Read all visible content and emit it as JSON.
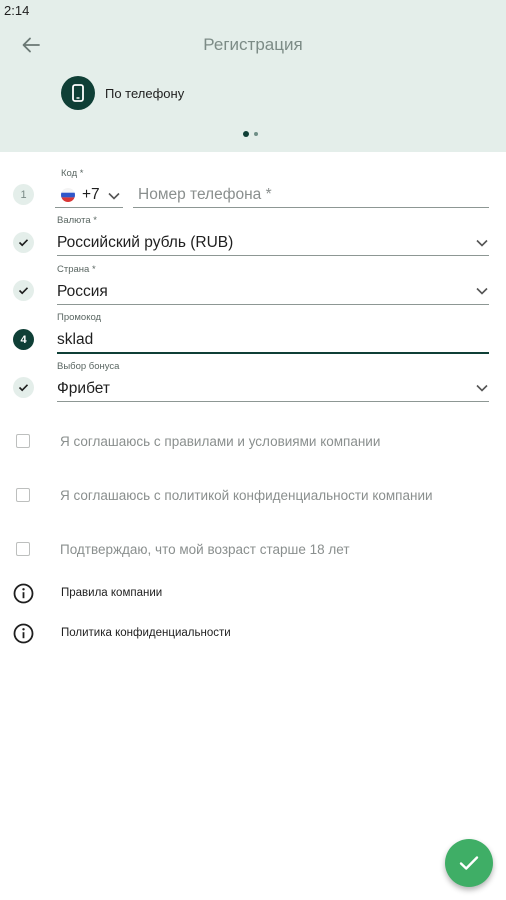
{
  "status_bar": {
    "time": "2:14"
  },
  "header": {
    "title": "Регистрация",
    "method_label": "По телефону"
  },
  "form": {
    "phone": {
      "step": "1",
      "code_label": "Код *",
      "code_value": "+7",
      "phone_placeholder": "Номер телефона *"
    },
    "currency": {
      "label": "Валюта *",
      "value": "Российский рубль (RUB)"
    },
    "country": {
      "label": "Страна *",
      "value": "Россия"
    },
    "promo": {
      "step": "4",
      "label": "Промокод",
      "value": "sklad"
    },
    "bonus": {
      "label": "Выбор бонуса",
      "value": "Фрибет"
    }
  },
  "agreements": [
    {
      "text": "Я соглашаюсь с правилами и условиями компании",
      "checked": false
    },
    {
      "text": "Я соглашаюсь с политикой конфиденциальности компании",
      "checked": false
    },
    {
      "text": "Подтверждаю, что мой возраст старше 18 лет",
      "checked": false
    }
  ],
  "links": [
    {
      "text": "Правила компании"
    },
    {
      "text": "Политика конфиденциальности"
    }
  ],
  "colors": {
    "header_bg": "#e4eeea",
    "accent_dark": "#0f3f36",
    "fab": "#3fae66"
  },
  "icons": {
    "back": "arrow-left-icon",
    "method": "smartphone-icon",
    "fab": "check-icon",
    "info": "info-icon"
  }
}
